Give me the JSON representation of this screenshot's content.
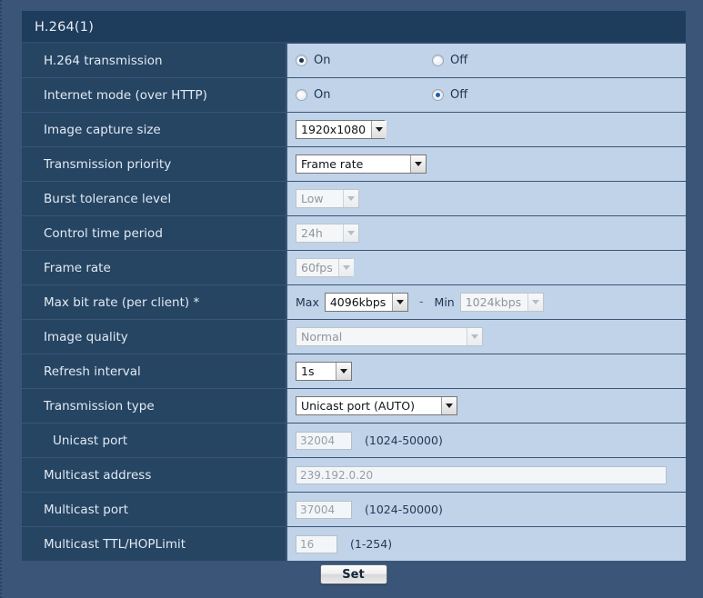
{
  "panel": {
    "title": "H.264(1)"
  },
  "rows": [
    {
      "label": "H.264 transmission",
      "kind": "radio",
      "options": [
        {
          "label": "On",
          "selected": true,
          "style": "on-dark"
        },
        {
          "label": "Off",
          "selected": false,
          "style": ""
        }
      ]
    },
    {
      "label": "Internet mode (over HTTP)",
      "kind": "radio",
      "options": [
        {
          "label": "On",
          "selected": false,
          "style": ""
        },
        {
          "label": "Off",
          "selected": true,
          "style": "on-blue"
        }
      ]
    },
    {
      "label": "Image capture size",
      "kind": "select",
      "value": "1920x1080",
      "enabled": true
    },
    {
      "label": "Transmission priority",
      "kind": "select",
      "value": "Frame rate",
      "enabled": true
    },
    {
      "label": "Burst tolerance level",
      "kind": "select",
      "value": "Low",
      "enabled": false
    },
    {
      "label": "Control time period",
      "kind": "select",
      "value": "24h",
      "enabled": false
    },
    {
      "label": "Frame rate",
      "kind": "select",
      "value": "60fps",
      "enabled": false
    },
    {
      "label": "Max bit rate (per client) *",
      "kind": "bitrate",
      "max_label": "Max",
      "max_value": "4096kbps",
      "separator": "-",
      "min_label": "Min",
      "min_value": "1024kbps"
    },
    {
      "label": "Image quality",
      "kind": "select",
      "value": "Normal",
      "enabled": false
    },
    {
      "label": "Refresh interval",
      "kind": "select",
      "value": "1s",
      "enabled": true
    },
    {
      "label": "Transmission type",
      "kind": "select",
      "value": "Unicast port (AUTO)",
      "enabled": true
    },
    {
      "label": "Unicast port",
      "indent": true,
      "kind": "text",
      "value": "32004",
      "hint": "(1024-50000)"
    },
    {
      "label": "Multicast address",
      "kind": "text-wide",
      "value": "239.192.0.20",
      "hint": ""
    },
    {
      "label": "Multicast port",
      "kind": "text",
      "value": "37004",
      "hint": "(1024-50000)"
    },
    {
      "label": "Multicast TTL/HOPLimit",
      "kind": "text-small",
      "value": "16",
      "hint": "(1-254)"
    }
  ],
  "footer": {
    "set_label": "Set"
  },
  "colors": {
    "page_background": "#3a5577",
    "header_bar": "#1e3c5c",
    "label_cell": "#254563",
    "value_cell": "#c1d3e8",
    "radio_selected_dark": "#1a3350",
    "radio_selected_blue": "#1d5fa8"
  }
}
